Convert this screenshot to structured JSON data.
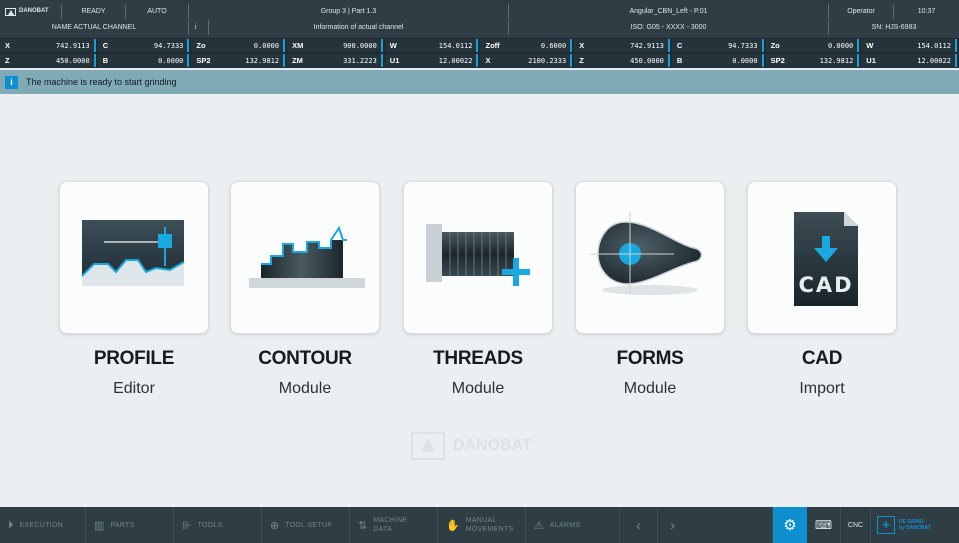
{
  "header": {
    "brand": "DANOBAT",
    "status": "READY",
    "mode": "AUTO",
    "group": "Group 3 | Part 1.3",
    "program": "Angular_CBN_Left - P.01",
    "user": "Operator",
    "time": "10:37",
    "channel_name": "NAME ACTUAL CHANNEL",
    "info_icon_glyph": "i",
    "channel_info": "Information of actual channel",
    "iso": "ISO: G05 - XXXX - 3000",
    "serial": "SN: HJS-6983"
  },
  "axes": {
    "row1": [
      {
        "name": "X",
        "value": "742.9113"
      },
      {
        "name": "C",
        "value": "94.7333"
      },
      {
        "name": "Zo",
        "value": "0.0000"
      },
      {
        "name": "XM",
        "value": "900.0000"
      },
      {
        "name": "W",
        "value": "154.0112"
      },
      {
        "name": "Zoff",
        "value": "0.6000"
      },
      {
        "name": "X",
        "value": "742.9113"
      },
      {
        "name": "C",
        "value": "94.7333"
      },
      {
        "name": "Zo",
        "value": "0.0000"
      },
      {
        "name": "W",
        "value": "154.0112"
      }
    ],
    "row2": [
      {
        "name": "Z",
        "value": "450.0000"
      },
      {
        "name": "B",
        "value": "0.0000"
      },
      {
        "name": "SP2",
        "value": "132.9812"
      },
      {
        "name": "ZM",
        "value": "331.2223"
      },
      {
        "name": "U1",
        "value": "12.00022"
      },
      {
        "name": "X",
        "value": "2100.2333"
      },
      {
        "name": "Z",
        "value": "450.0000"
      },
      {
        "name": "B",
        "value": "0.0000"
      },
      {
        "name": "SP2",
        "value": "132.9812"
      },
      {
        "name": "U1",
        "value": "12.00022"
      }
    ]
  },
  "message": {
    "icon_glyph": "i",
    "text": "The machine is ready to start grinding"
  },
  "modules": [
    {
      "title": "PROFILE",
      "subtitle": "Editor"
    },
    {
      "title": "CONTOUR",
      "subtitle": "Module"
    },
    {
      "title": "THREADS",
      "subtitle": "Module"
    },
    {
      "title": "FORMS",
      "subtitle": "Module"
    },
    {
      "title": "CAD",
      "subtitle": "Import"
    }
  ],
  "cad_icon_text": "CAD",
  "watermark": "DANOBAT",
  "footer": {
    "items": [
      {
        "icon": "execution-icon",
        "glyph": "⏵",
        "label": "EXECUTION",
        "sub": ""
      },
      {
        "icon": "parts-icon",
        "glyph": "▥",
        "label": "PARTS",
        "sub": ""
      },
      {
        "icon": "tools-icon",
        "glyph": "⊪",
        "label": "TOOLS",
        "sub": ""
      },
      {
        "icon": "tool-setup-icon",
        "glyph": "⊕",
        "label": "TOOL SETUP",
        "sub": ""
      },
      {
        "icon": "machine-data-icon",
        "glyph": "⇅",
        "label": "MACHINE",
        "sub": "DATA"
      },
      {
        "icon": "manual-movements-icon",
        "glyph": "✋",
        "label": "MANUAL",
        "sub": "MOVEMENTS"
      },
      {
        "icon": "alarms-icon",
        "glyph": "⚠",
        "label": "ALARMS",
        "sub": ""
      }
    ],
    "prev_glyph": "‹",
    "next_glyph": "›",
    "gear_glyph": "⚙",
    "keyboard_glyph": "⌨",
    "cnc_label": "CNC",
    "brand_plus": "+",
    "brand_line1": "DE GRIND",
    "brand_line2": "by DANOBAT"
  },
  "colors": {
    "accent": "#0e8fd0",
    "header_bg": "#2f3e45",
    "axis_bg": "#1f2b31",
    "message_bg": "#7faab6"
  }
}
